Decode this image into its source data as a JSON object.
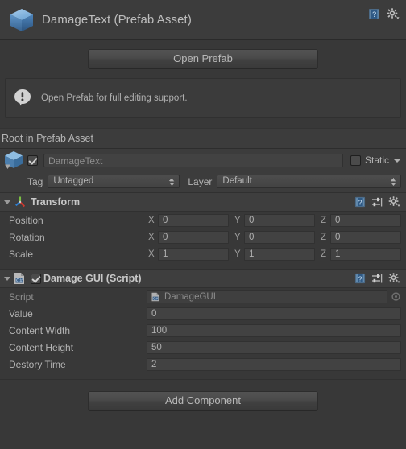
{
  "asset_header": {
    "title": "DamageText (Prefab Asset)",
    "icon": "prefab-cube-icon",
    "help_icon": "help-book-icon",
    "gear_icon": "gear-icon"
  },
  "open_prefab": {
    "label": "Open Prefab"
  },
  "info_box": {
    "icon": "info-bubble-icon",
    "message": "Open Prefab for full editing support."
  },
  "root_bar": {
    "label": "Root in Prefab Asset"
  },
  "gameobject": {
    "icon": "prefab-cube-icon",
    "enabled": true,
    "name": "DamageText",
    "static_label": "Static",
    "static_checked": false,
    "tag_label": "Tag",
    "tag_value": "Untagged",
    "layer_label": "Layer",
    "layer_value": "Default"
  },
  "components": [
    {
      "name": "Transform",
      "icon": "transform-axis-icon",
      "has_enable_checkbox": false,
      "help_icon": "help-book-icon",
      "preset_icon": "preset-settings-icon",
      "gear_icon": "gear-icon",
      "rows": [
        {
          "label": "Position",
          "type": "vector3",
          "axes": [
            "X",
            "Y",
            "Z"
          ],
          "values": [
            "0",
            "0",
            "0"
          ]
        },
        {
          "label": "Rotation",
          "type": "vector3",
          "axes": [
            "X",
            "Y",
            "Z"
          ],
          "values": [
            "0",
            "0",
            "0"
          ]
        },
        {
          "label": "Scale",
          "type": "vector3",
          "axes": [
            "X",
            "Y",
            "Z"
          ],
          "values": [
            "1",
            "1",
            "1"
          ]
        }
      ]
    },
    {
      "name": "Damage GUI (Script)",
      "icon": "csharp-script-icon",
      "has_enable_checkbox": true,
      "enabled": true,
      "help_icon": "help-book-icon",
      "preset_icon": "preset-settings-icon",
      "gear_icon": "gear-icon",
      "rows": [
        {
          "label": "Script",
          "type": "object",
          "value": "DamageGUI",
          "icon": "csharp-script-icon",
          "picker": "object-picker-icon",
          "readonly": true
        },
        {
          "label": "Value",
          "type": "number",
          "value": "0"
        },
        {
          "label": "Content Width",
          "type": "number",
          "value": "100"
        },
        {
          "label": "Content Height",
          "type": "number",
          "value": "50"
        },
        {
          "label": "Destory Time",
          "type": "number",
          "value": "2"
        }
      ]
    }
  ],
  "add_component": {
    "label": "Add Component"
  },
  "colors": {
    "window_bg": "#383838",
    "panel_bg": "#3c3c3c",
    "field_bg": "#424242",
    "text": "#b4b4b4",
    "text_dim": "#8c8c8c",
    "axis_x": "#d13a2f",
    "axis_y": "#7bc043",
    "axis_z": "#2f7fd1"
  }
}
